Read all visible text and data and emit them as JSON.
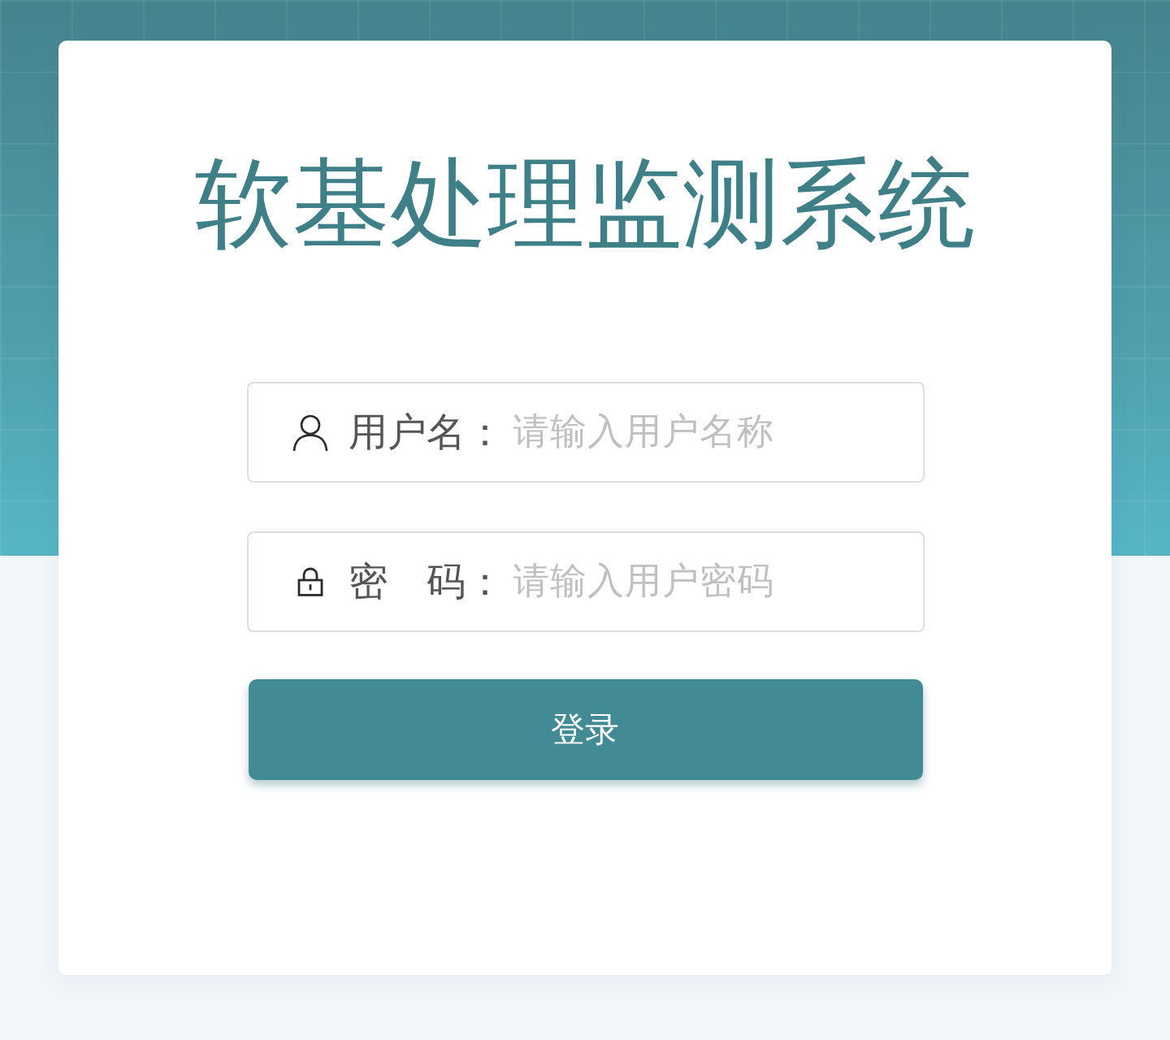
{
  "title": "软基处理监测系统",
  "fields": [
    {
      "kind": "user",
      "label": "用户名：",
      "placeholder": "请输入用户名称"
    },
    {
      "kind": "password",
      "label": "密　码：",
      "placeholder": "请输入用户密码"
    }
  ],
  "login_button": "登录"
}
